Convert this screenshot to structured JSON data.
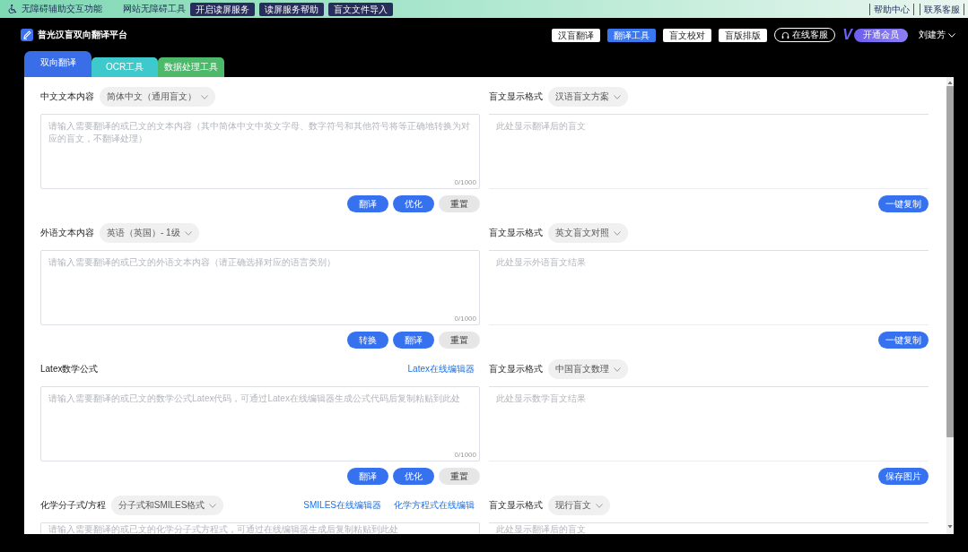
{
  "accessibility_bar": {
    "title": "无障碍辅助交互功能",
    "tools_label": "网站无障碍工具",
    "buttons": [
      "开启读屏服务",
      "读屏服务帮助",
      "盲文文件导入"
    ],
    "links": [
      "帮助中心",
      "联系客服"
    ]
  },
  "header": {
    "title": "普光汉盲双向翻译平台",
    "nav": [
      {
        "label": "汉盲翻译",
        "selected": false
      },
      {
        "label": "翻译工具",
        "selected": true
      },
      {
        "label": "盲文校对",
        "selected": false
      },
      {
        "label": "盲版排版",
        "selected": false
      }
    ],
    "service_button": "在线客服",
    "vip_logo": "V",
    "vip_button": "开通会员",
    "user": "刘建芳"
  },
  "tabs": [
    {
      "label": "双向翻译",
      "selected": true,
      "color": "#3a6ee8"
    },
    {
      "label": "OCR工具",
      "selected": false,
      "color": "#3ecacc"
    },
    {
      "label": "数据处理工具",
      "selected": false,
      "color": "#4db96b"
    }
  ],
  "sections": [
    {
      "input": {
        "label": "中文文本内容",
        "select": "简体中文（通用盲文）",
        "placeholder": "请输入需要翻译的或已文的文本内容（其中简体中文中英文字母、数字符号和其他符号将等正确地转换为对应的盲文，不翻译处理）",
        "count": "0/1000",
        "buttons": [
          {
            "label": "翻译",
            "kind": "primary"
          },
          {
            "label": "优化",
            "kind": "primary"
          },
          {
            "label": "重置",
            "kind": "plain"
          }
        ]
      },
      "output": {
        "label": "盲文显示格式",
        "select": "汉语盲文方案",
        "placeholder": "此处显示翻译后的盲文",
        "button": "一键复制"
      }
    },
    {
      "input": {
        "label": "外语文本内容",
        "select": "英语（英国）- 1级",
        "placeholder": "请输入需要翻译的或已文的外语文本内容（请正确选择对应的语言类别）",
        "count": "0/1000",
        "buttons": [
          {
            "label": "转换",
            "kind": "primary"
          },
          {
            "label": "翻译",
            "kind": "primary"
          },
          {
            "label": "重置",
            "kind": "plain"
          }
        ]
      },
      "output": {
        "label": "盲文显示格式",
        "select": "英文盲文对照",
        "placeholder": "此处显示外语盲文结果",
        "button": "一键复制"
      }
    },
    {
      "input": {
        "label": "Latex数学公式",
        "links": [
          "Latex在线编辑器"
        ],
        "placeholder": "请输入需要翻译的或已文的数学公式Latex代码，可通过Latex在线编辑器生成公式代码后复制粘贴到此处",
        "count": "0/1000",
        "buttons": [
          {
            "label": "翻译",
            "kind": "primary"
          },
          {
            "label": "优化",
            "kind": "primary"
          },
          {
            "label": "重置",
            "kind": "plain"
          }
        ]
      },
      "output": {
        "label": "盲文显示格式",
        "select": "中国盲文数理",
        "placeholder": "此处显示数学盲文结果",
        "button": "保存图片"
      }
    },
    {
      "input": {
        "label": "化学分子式/方程",
        "select": "分子式和SMILES格式",
        "links": [
          "SMILES在线编辑器",
          "化学方程式在线编辑"
        ],
        "placeholder": "请输入需要翻译的或已文的化学分子式方程式，可通过在线编辑器生成后复制粘贴到此处"
      },
      "output": {
        "label": "盲文显示格式",
        "select": "现行盲文",
        "placeholder": "此处显示翻译后的盲文"
      }
    }
  ]
}
